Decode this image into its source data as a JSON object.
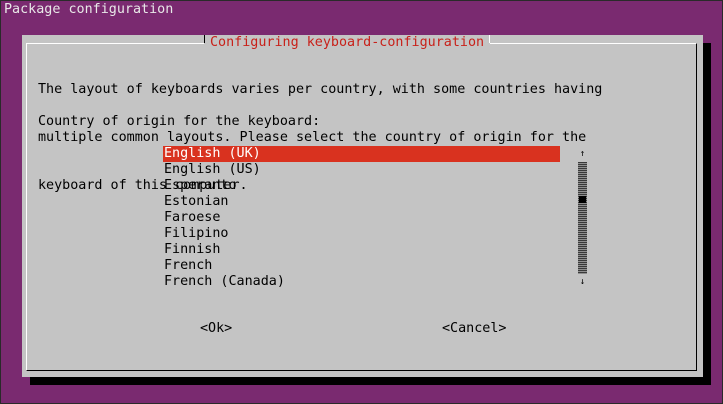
{
  "terminal": {
    "title": "Package configuration"
  },
  "dialog": {
    "title": "Configuring keyboard-configuration",
    "description_lines": [
      "The layout of keyboards varies per country, with some countries having",
      "multiple common layouts. Please select the country of origin for the",
      "keyboard of this computer."
    ],
    "prompt": "Country of origin for the keyboard:",
    "list": {
      "selected": "English (UK)",
      "items": [
        "English (UK)",
        "English (US)",
        "Esperanto",
        "Estonian",
        "Faroese",
        "Filipino",
        "Finnish",
        "French",
        "French (Canada)"
      ]
    },
    "scrollbar": {
      "up_arrow": "↑",
      "down_arrow": "↓",
      "up_icon": "arrow-up-icon",
      "down_icon": "arrow-down-icon"
    },
    "buttons": {
      "ok": "<Ok>",
      "cancel": "<Cancel>"
    }
  },
  "colors": {
    "terminal_background": "#7a2a70",
    "dialog_background": "#c4c4c4",
    "title_text": "#c8211a",
    "selection_background": "#d9321f",
    "selection_text": "#ffffff"
  }
}
